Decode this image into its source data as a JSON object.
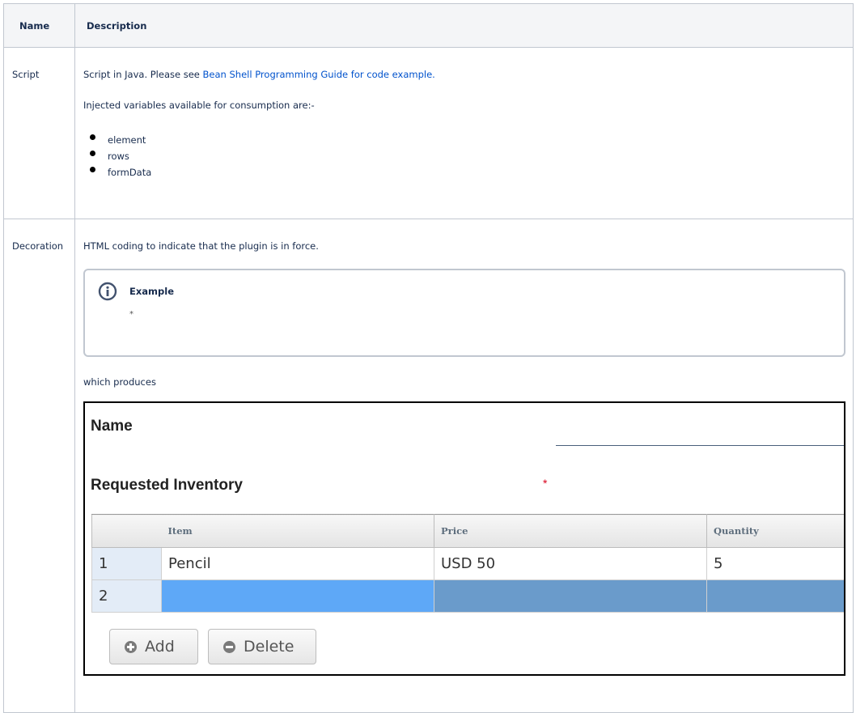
{
  "table": {
    "headers": {
      "name": "Name",
      "description": "Description"
    },
    "rows": [
      {
        "name": "Script",
        "text_before_link": "Script in Java. Please see ",
        "link_text": "Bean Shell Programming Guide for code example.",
        "injected_text": "Injected variables available for consumption are:-",
        "variables": [
          "element",
          "rows",
          "formData"
        ]
      },
      {
        "name": "Decoration",
        "text": "HTML coding to indicate that the plugin is in force.",
        "info_panel": {
          "title": "Example",
          "body": "*",
          "icon": "info-icon"
        },
        "produces_text": "which produces"
      }
    ]
  },
  "form_preview": {
    "name_label": "Name",
    "inventory_label": "Requested Inventory",
    "required_marker": "*",
    "grid": {
      "columns": [
        "Item",
        "Price",
        "Quantity"
      ],
      "rows": [
        {
          "num": "1",
          "item": "Pencil",
          "price": "USD 50",
          "quantity": "5"
        },
        {
          "num": "2",
          "item": "",
          "price": "",
          "quantity": ""
        }
      ]
    },
    "buttons": {
      "add_label": "Add",
      "delete_label": "Delete"
    },
    "colors": {
      "selected_row": "#5ea8f7",
      "required": "#d8001b",
      "link": "#0052cc"
    }
  }
}
